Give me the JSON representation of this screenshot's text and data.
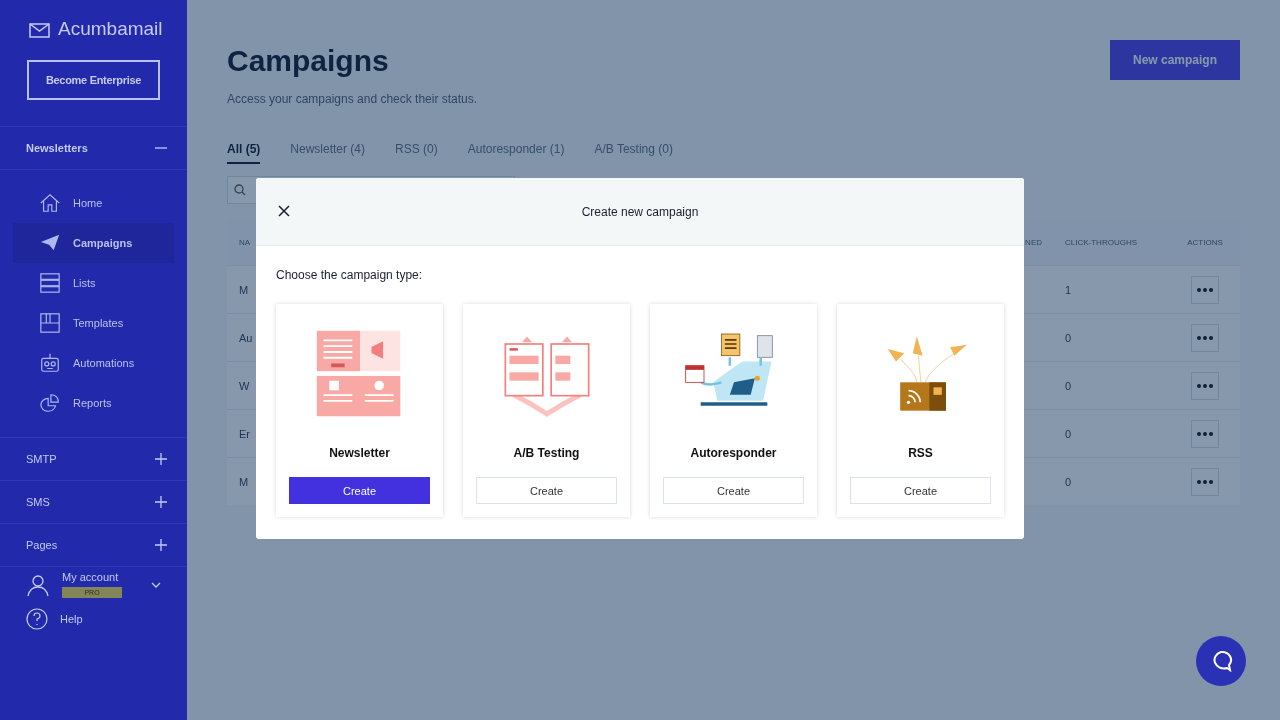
{
  "sidebar": {
    "logo": "Acumbamail",
    "enterprise_button": "Become Enterprise",
    "sections": [
      {
        "label": "Newsletters",
        "expanded": true,
        "items": [
          {
            "label": "Home",
            "selected": false
          },
          {
            "label": "Campaigns",
            "selected": true
          },
          {
            "label": "Lists",
            "selected": false
          },
          {
            "label": "Templates",
            "selected": false
          },
          {
            "label": "Automations",
            "selected": false
          },
          {
            "label": "Reports",
            "selected": false
          }
        ]
      },
      {
        "label": "SMTP",
        "expanded": false
      },
      {
        "label": "SMS",
        "expanded": false
      },
      {
        "label": "Pages",
        "expanded": false
      }
    ],
    "account": {
      "label": "My account",
      "badge": "PRO"
    },
    "help": "Help"
  },
  "main": {
    "title": "Campaigns",
    "subtitle": "Access your campaigns and check their status.",
    "new_button": "New campaign",
    "tabs": [
      {
        "label": "All (5)",
        "selected": true
      },
      {
        "label": "Newsletter (4)",
        "selected": false
      },
      {
        "label": "RSS (0)",
        "selected": false
      },
      {
        "label": "Autoresponder (1)",
        "selected": false
      },
      {
        "label": "A/B Testing (0)",
        "selected": false
      }
    ],
    "table": {
      "columns": [
        "NA",
        "NED",
        "CLICK-THROUGHS",
        "ACTIONS"
      ],
      "rows": [
        {
          "column_1": "M",
          "click_throughs": "1"
        },
        {
          "column_1": "Au",
          "click_throughs": "0"
        },
        {
          "column_1": "W",
          "click_throughs": "0"
        },
        {
          "column_1": "Er",
          "click_throughs": "0"
        },
        {
          "column_1": "M",
          "click_throughs": "0"
        }
      ]
    }
  },
  "modal": {
    "title": "Create new campaign",
    "prompt": "Choose the campaign type:",
    "types": [
      {
        "kind": "newsletter",
        "label": "Newsletter",
        "button": "Create",
        "primary": true
      },
      {
        "kind": "ab",
        "label": "A/B Testing",
        "button": "Create",
        "primary": false
      },
      {
        "kind": "autoresponder",
        "label": "Autoresponder",
        "button": "Create",
        "primary": false
      },
      {
        "kind": "rss",
        "label": "RSS",
        "button": "Create",
        "primary": false
      }
    ]
  }
}
